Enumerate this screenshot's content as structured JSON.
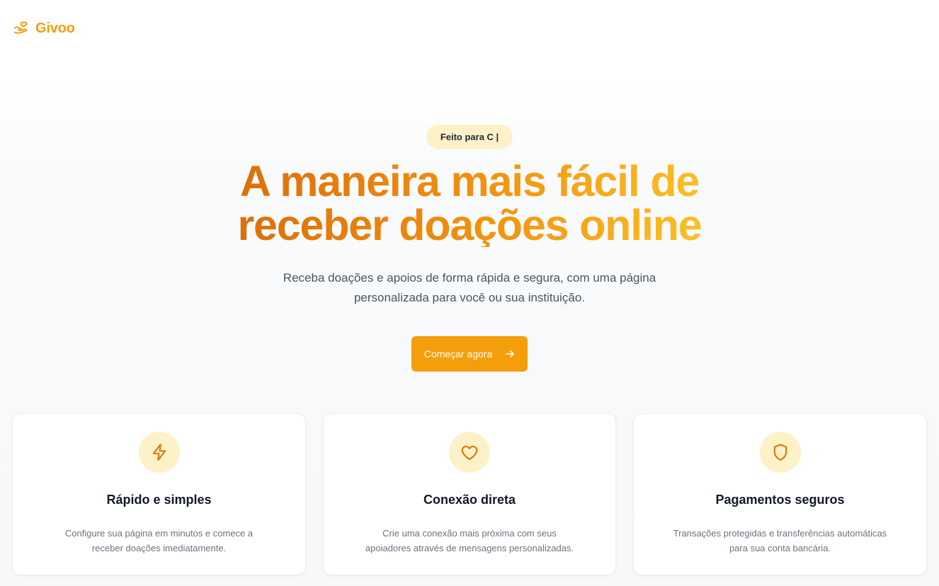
{
  "header": {
    "logo_icon": "hand-heart-icon",
    "brand": "Givoo"
  },
  "hero": {
    "badge": "Feito para C |",
    "headline_line1": "A maneira mais fácil de",
    "headline_line2": "receber doações online",
    "subtitle_line1": "Receba doações e apoios de forma rápida e segura, com uma página",
    "subtitle_line2": "personalizada para você ou sua instituição.",
    "cta_label": "Começar agora",
    "cta_icon": "arrow-right-icon"
  },
  "features": [
    {
      "icon": "lightning-icon",
      "title": "Rápido e simples",
      "desc_line1": "Configure sua página em minutos e comece a",
      "desc_line2": "receber doações imediatamente."
    },
    {
      "icon": "heart-icon",
      "title": "Conexão direta",
      "desc_line1": "Crie uma conexão mais próxima com seus",
      "desc_line2": "apoiadores através de mensagens personalizadas."
    },
    {
      "icon": "shield-icon",
      "title": "Pagamentos seguros",
      "desc_line1": "Transações protegidas e transferências automáticas",
      "desc_line2": "para sua conta bancária."
    }
  ],
  "colors": {
    "accent": "#f59e0b",
    "accent_dark": "#dc6f0a",
    "badge_bg": "#fdf1c7",
    "icon_stroke": "#d97706",
    "text_dark": "#111827",
    "text_muted": "#6b7280"
  }
}
